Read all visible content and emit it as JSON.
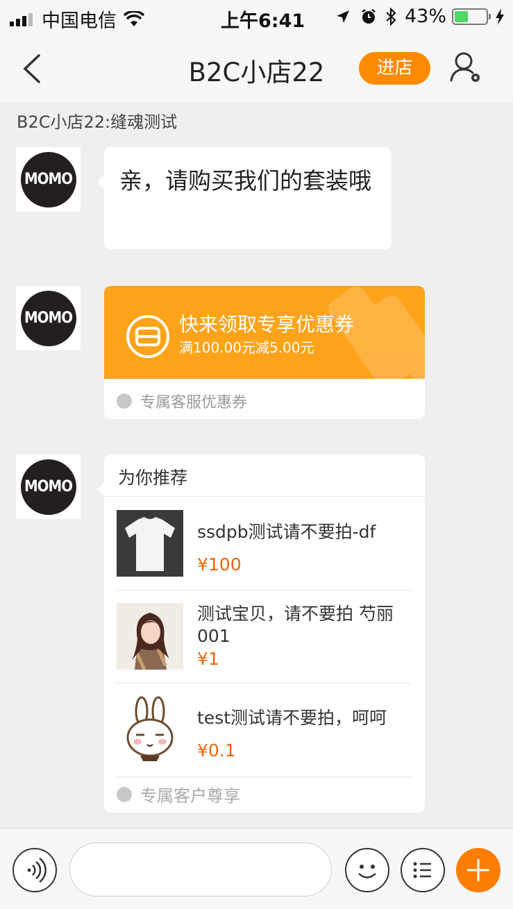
{
  "status_bar": {
    "carrier": "中国电信",
    "time": "上午6:41",
    "battery": "43%",
    "battery_level": 0.43,
    "icons": [
      "signal-icon",
      "wifi-icon",
      "location-icon",
      "alarm-icon",
      "bluetooth-icon",
      "battery-icon",
      "charging-icon"
    ]
  },
  "nav": {
    "title": "B2C小店22",
    "enter_store_label": "进店",
    "icons": [
      "back-icon",
      "user-settings-icon"
    ]
  },
  "chat": {
    "subtitle": "B2C小店22:缝魂测试",
    "avatar_text": "MOMO",
    "text_message": "亲，请购买我们的套装哦",
    "coupon": {
      "title": "快来领取专享优惠券",
      "description": "满100.00元减5.00元",
      "footer": "专属客服优惠券",
      "color": "#ffa31a"
    },
    "recommend": {
      "header": "为你推荐",
      "products": [
        {
          "name": "ssdpb测试请不要拍-df",
          "price": "¥100",
          "thumb": "white-tshirt"
        },
        {
          "name": "测试宝贝，请不要拍 芍丽001",
          "price": "¥1",
          "thumb": "woman-photo"
        },
        {
          "name": "test测试请不要拍，呵呵",
          "price": "¥0.1",
          "thumb": "rabbit-cartoon"
        }
      ],
      "footer": "专属客户尊享",
      "price_color": "#f0650a"
    }
  },
  "input_bar": {
    "placeholder": "",
    "icons": [
      "voice-icon",
      "emoji-icon",
      "menu-icon",
      "plus-icon"
    ],
    "accent": "#ff7d00"
  }
}
